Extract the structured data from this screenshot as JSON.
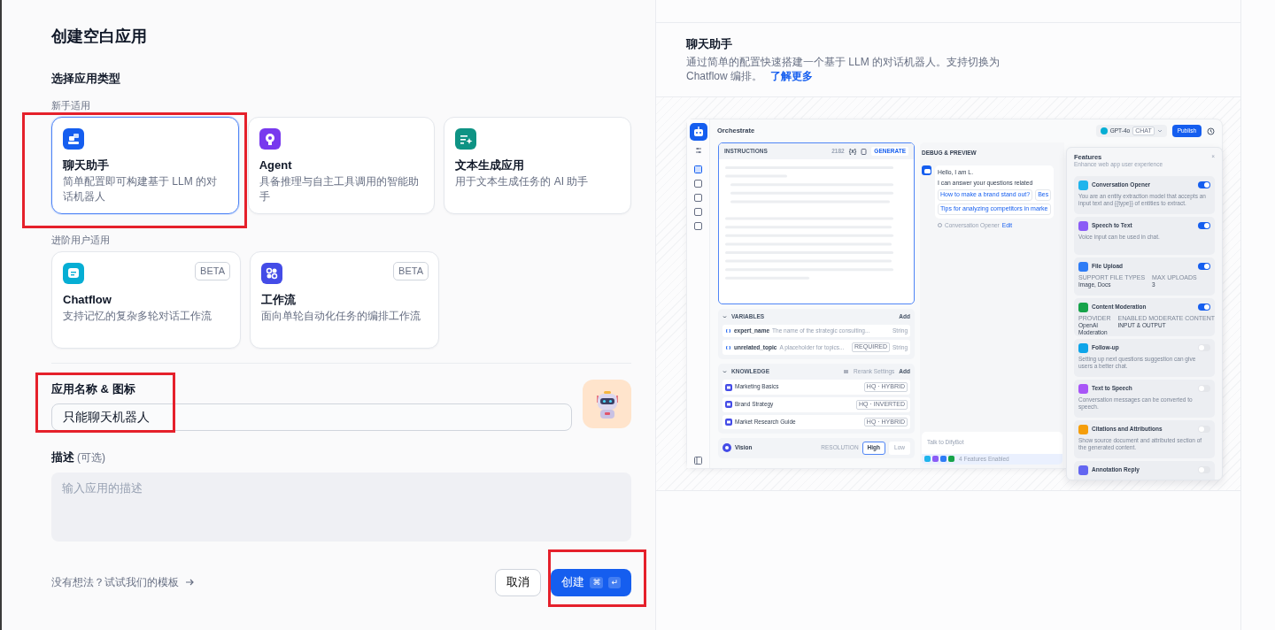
{
  "form": {
    "title": "创建空白应用",
    "type_heading": "选择应用类型",
    "groups": [
      {
        "label": "新手适用",
        "types": [
          {
            "kind": "chat",
            "name": "聊天助手",
            "description": "简单配置即可构建基于 LLM 的对话机器人",
            "selected": true,
            "highlighted": true
          },
          {
            "kind": "agent",
            "name": "Agent",
            "description": "具备推理与自主工具调用的智能助手",
            "selected": false,
            "highlighted": false
          },
          {
            "kind": "text",
            "name": "文本生成应用",
            "description": "用于文本生成任务的 AI 助手",
            "selected": false,
            "highlighted": false
          }
        ]
      },
      {
        "label": "进阶用户适用",
        "types": [
          {
            "kind": "chatflow",
            "name": "Chatflow",
            "badge": "BETA",
            "description": "支持记忆的复杂多轮对话工作流",
            "selected": false,
            "highlighted": false
          },
          {
            "kind": "workflow",
            "name": "工作流",
            "badge": "BETA",
            "description": "面向单轮自动化任务的编排工作流",
            "selected": false,
            "highlighted": false
          }
        ]
      }
    ],
    "name_label": "应用名称 & 图标",
    "name_value": "只能聊天机器人",
    "name_highlighted": true,
    "description_label": "描述",
    "description_optional": "(可选)",
    "description_placeholder": "输入应用的描述",
    "template_link": "没有想法？试试我们的模板",
    "cancel": "取消",
    "create": {
      "label": "创建",
      "keys": [
        "⌘",
        "↵"
      ],
      "highlighted": true
    }
  },
  "preview": {
    "title": "聊天助手",
    "description": "通过简单的配置快速搭建一个基于 LLM 的对话机器人。支持切换为 Chatflow 编排。",
    "link": "了解更多",
    "app": {
      "title": "Orchestrate",
      "model": {
        "name": "GPT-4o",
        "tag": "CHAT"
      },
      "publish": "Publish",
      "instructions": {
        "label": "INSTRUCTIONS",
        "count": "2182",
        "var": "{x}",
        "generate": "GENERATE"
      },
      "variables": {
        "label": "VARIABLES",
        "add": "Add",
        "items": [
          {
            "name": "expert_name",
            "description": "The name of the strategic consulting...",
            "type": "String"
          },
          {
            "name": "unrelated_topic",
            "description": "A placeholder for topics...",
            "tag": "REQUIRED",
            "type": "String"
          }
        ]
      },
      "knowledge": {
        "label": "KNOWLEDGE",
        "rerank": "Rerank Settings",
        "add": "Add",
        "items": [
          {
            "name": "Marketing Basics",
            "tag": "HQ · HYBRID"
          },
          {
            "name": "Brand Strategy",
            "tag": "HQ · INVERTED"
          },
          {
            "name": "Market Research Guide",
            "tag": "HQ · HYBRID"
          }
        ]
      },
      "vision": {
        "label": "Vision",
        "resolution": "RESOLUTION",
        "options": [
          {
            "label": "High",
            "selected": true
          },
          {
            "label": "Low",
            "selected": false
          }
        ]
      },
      "debug": {
        "title": "DEBUG & PREVIEW",
        "greeting": [
          "Hello, I am L.",
          "I can answer your questions related"
        ],
        "suggestions": [
          "How to make a brand stand out?",
          "Bes",
          "Tips for analyzing competitors in marke"
        ],
        "opener": "Conversation Opener",
        "edit": "Edit",
        "input_placeholder": "Talk to DifyBot",
        "features_enabled": "4 Features Enabled"
      },
      "features": {
        "title": "Features",
        "subtitle": "Enhance web app user experience",
        "close": "×",
        "items": [
          {
            "name": "Conversation Opener",
            "color": "#1fb4ec",
            "on": true,
            "description": "You are an entity extraction model that accepts an input text and {{type}} of entities to extract."
          },
          {
            "name": "Speech to Text",
            "color": "#8b5cf6",
            "on": true,
            "description": "Voice input can be used in chat."
          },
          {
            "name": "File Upload",
            "color": "#2e7cf6",
            "on": true,
            "fields": [
              {
                "label": "SUPPORT FILE TYPES",
                "value": "Image, Docs"
              },
              {
                "label": "MAX UPLOADS",
                "value": "3"
              }
            ]
          },
          {
            "name": "Content Moderation",
            "color": "#16a34a",
            "on": true,
            "fields": [
              {
                "label": "PROVIDER",
                "value": "OpenAI Moderation"
              },
              {
                "label": "ENABLED MODERATE CONTENT",
                "value": "INPUT & OUTPUT"
              }
            ]
          },
          {
            "name": "Follow-up",
            "color": "#0ea5e9",
            "on": false,
            "description": "Setting up next questions suggestion can give users a better chat."
          },
          {
            "name": "Text to Speech",
            "color": "#a855f7",
            "on": false,
            "description": "Conversation messages can be converted to speech."
          },
          {
            "name": "Citations and Attributions",
            "color": "#f59e0b",
            "on": false,
            "description": "Show source document and attributed section of the generated content."
          },
          {
            "name": "Annotation Reply",
            "color": "#6366f1",
            "on": false
          }
        ]
      }
    }
  }
}
